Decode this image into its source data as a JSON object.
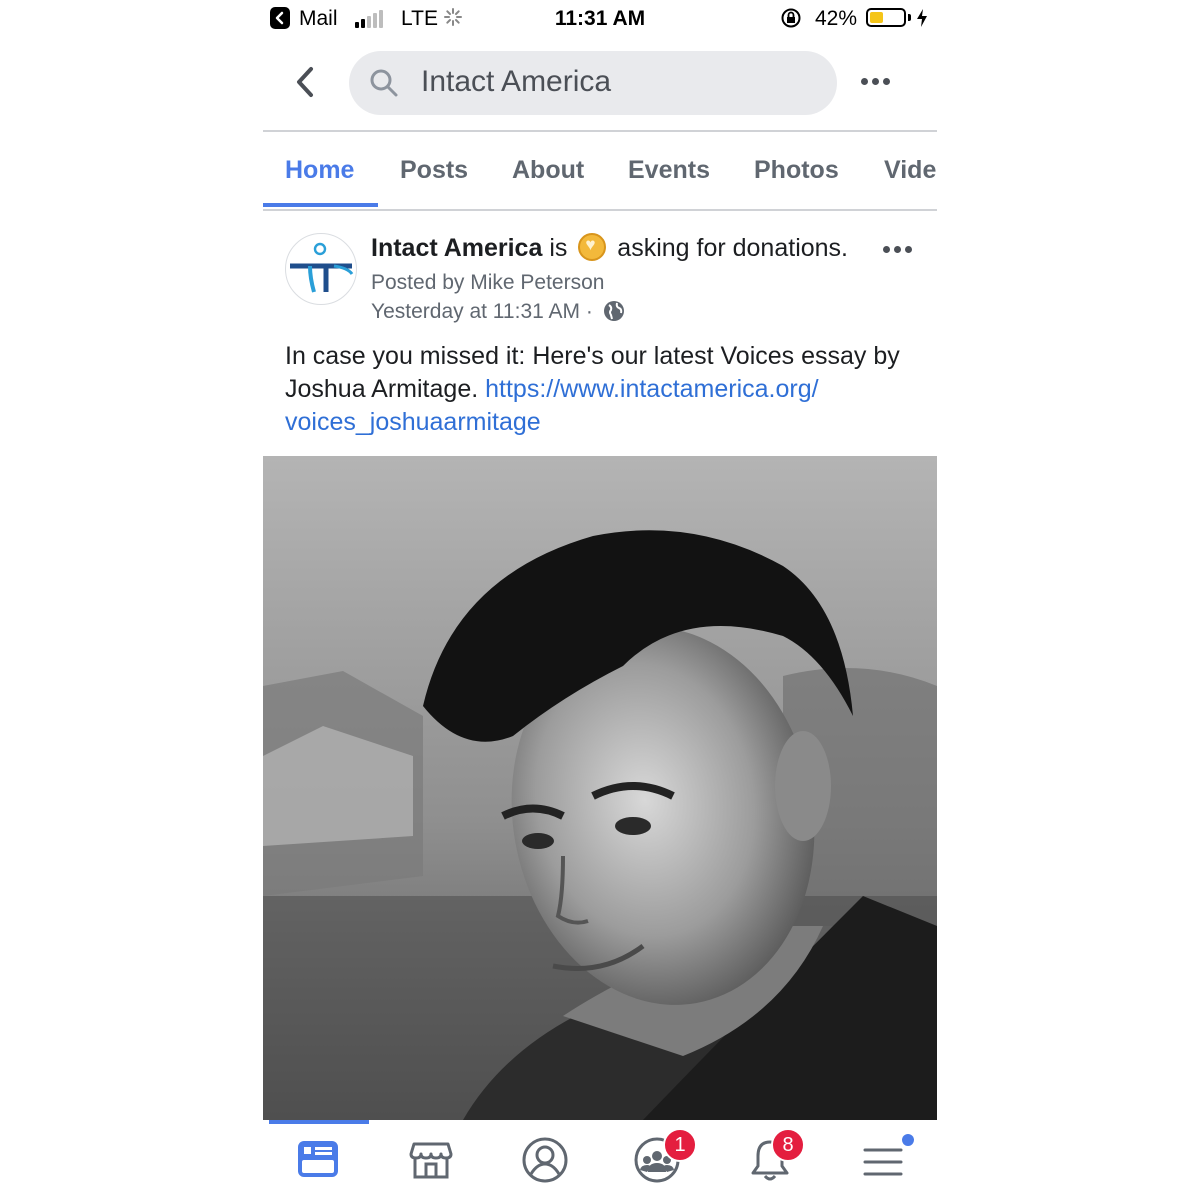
{
  "status_bar": {
    "back_app": "Mail",
    "network": "LTE",
    "time": "11:31 AM",
    "battery_percent": "42%",
    "battery_level": 0.42,
    "battery_color": "#f5c518"
  },
  "header": {
    "search_text": "Intact America",
    "back_icon": "chevron-left-icon",
    "search_icon": "search-icon",
    "more_icon": "more-horizontal-icon"
  },
  "tabs": [
    {
      "label": "Home",
      "active": true
    },
    {
      "label": "Posts",
      "active": false
    },
    {
      "label": "About",
      "active": false
    },
    {
      "label": "Events",
      "active": false
    },
    {
      "label": "Photos",
      "active": false
    },
    {
      "label": "Vide",
      "active": false
    }
  ],
  "post": {
    "page_name": "Intact America",
    "action_pre": "is",
    "action_post": "asking for donations.",
    "posted_by": "Posted by Mike Peterson",
    "time": "Yesterday at 11:31 AM",
    "time_separator": "·",
    "text": "In case you missed it: Here's our latest Voices essay by Joshua Armitage.",
    "link": "https://www.intactamerica.org/voices_joshuaarmitage",
    "link_line1": "https://www.intactamerica.org/",
    "link_line2": "voices_joshuaarmitage"
  },
  "bottom_nav": {
    "items": [
      "news-feed-icon",
      "marketplace-icon",
      "profile-icon",
      "groups-icon",
      "notifications-icon",
      "menu-icon"
    ],
    "groups_badge": "1",
    "notifications_badge": "8"
  },
  "colors": {
    "accent": "#4a7be8",
    "link": "#2f6fd6",
    "badge": "#e41e3f"
  }
}
